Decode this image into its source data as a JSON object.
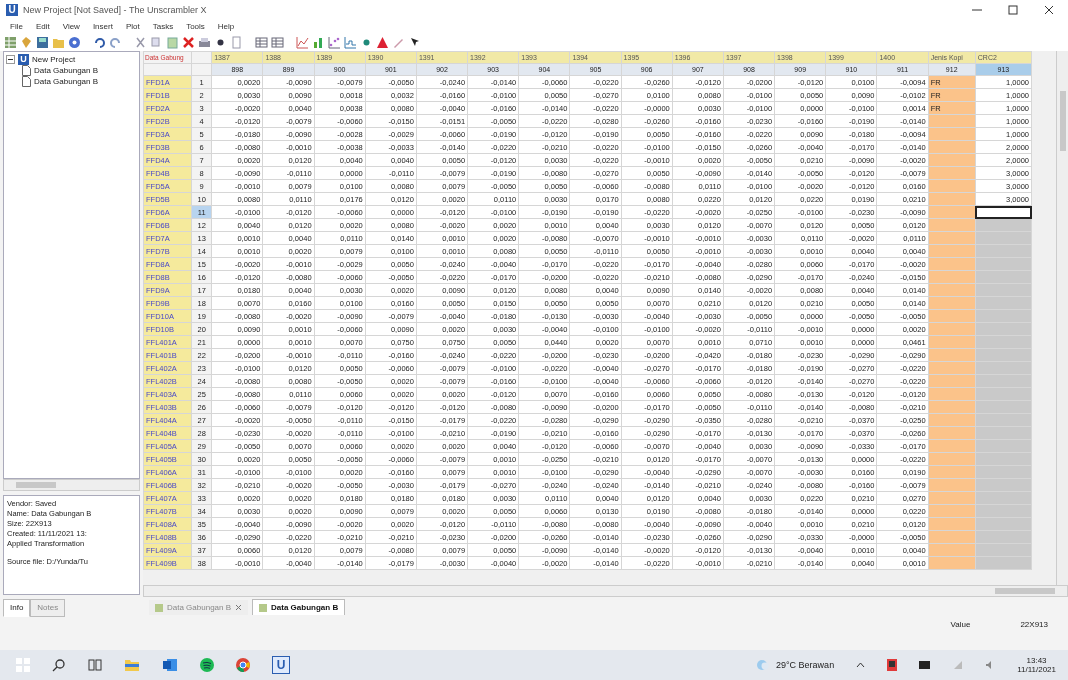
{
  "window": {
    "title": "New Project [Not Saved] - The Unscrambler X",
    "icon_glyph": "U"
  },
  "menu": [
    "File",
    "Edit",
    "View",
    "Insert",
    "Plot",
    "Tasks",
    "Tools",
    "Help"
  ],
  "project_tree": {
    "label": "New Project",
    "icon_glyph": "U",
    "expanded": true,
    "children": [
      {
        "label": "Data Gabungan B"
      },
      {
        "label": "Data Gabungan B"
      }
    ]
  },
  "info_panel": {
    "lines": [
      "Vendor: Saved",
      "Name: Data Gabungan B",
      "Size: 22X913",
      "Created: 11/11/2021 13:",
      "Applied Transformation",
      "Source file: D:/Yunda/Tu"
    ]
  },
  "side_tabs": [
    {
      "label": "Info",
      "selected": true
    },
    {
      "label": "Notes",
      "selected": false
    }
  ],
  "table": {
    "corner": "Data Gabung",
    "top_headers": [
      "1387",
      "1388",
      "1389",
      "1390",
      "1391",
      "1392",
      "1393",
      "1394",
      "1395",
      "1396",
      "1397",
      "1398",
      "1399",
      "1400",
      "Jenis Kopi",
      "CRC2"
    ],
    "sub_headers": [
      "898",
      "899",
      "900",
      "901",
      "902",
      "903",
      "904",
      "905",
      "906",
      "907",
      "908",
      "909",
      "910",
      "911",
      "912",
      "913"
    ],
    "rows": [
      {
        "name": "FFD1A",
        "index": "1",
        "selected": false,
        "jenis_kopi": "FR",
        "last_value": "1,0000",
        "values": [
          "0,0020",
          "-0,0090",
          "-0,0079",
          "-0,0050",
          "-0,0240",
          "-0,0140",
          "-0,0060",
          "-0,0220",
          "-0,0260",
          "-0,0120",
          "-0,0200",
          "-0,0120",
          "0,0100",
          "-0,0094"
        ]
      },
      {
        "name": "FFD1B",
        "index": "2",
        "selected": false,
        "jenis_kopi": "FR",
        "last_value": "1,0000",
        "values": [
          "0,0030",
          "0,0090",
          "0,0018",
          "0,0032",
          "-0,0160",
          "-0,0100",
          "0,0050",
          "-0,0270",
          "0,0100",
          "0,0080",
          "-0,0100",
          "0,0050",
          "0,0090",
          "-0,0102"
        ]
      },
      {
        "name": "FFD2A",
        "index": "3",
        "selected": false,
        "jenis_kopi": "FR",
        "last_value": "1,0000",
        "values": [
          "-0,0020",
          "0,0040",
          "0,0038",
          "0,0080",
          "-0,0040",
          "-0,0160",
          "-0,0140",
          "-0,0220",
          "-0,0000",
          "0,0030",
          "-0,0100",
          "0,0000",
          "-0,0100",
          "0,0014"
        ]
      },
      {
        "name": "FFD2B",
        "index": "4",
        "selected": false,
        "last_value": "1,0000",
        "values": [
          "-0,0120",
          "-0,0079",
          "-0,0060",
          "-0,0150",
          "-0,0151",
          "-0,0050",
          "-0,0220",
          "-0,0280",
          "-0,0260",
          "-0,0160",
          "-0,0230",
          "-0,0160",
          "-0,0190",
          "-0,0140"
        ]
      },
      {
        "name": "FFD3A",
        "index": "5",
        "selected": false,
        "last_value": "1,0000",
        "values": [
          "-0,0180",
          "-0,0090",
          "-0,0028",
          "-0,0029",
          "-0,0060",
          "-0,0190",
          "-0,0120",
          "-0,0190",
          "0,0050",
          "-0,0160",
          "-0,0220",
          "0,0090",
          "-0,0180",
          "-0,0094"
        ]
      },
      {
        "name": "FFD3B",
        "index": "6",
        "selected": false,
        "last_value": "2,0000",
        "values": [
          "-0,0080",
          "-0,0010",
          "-0,0038",
          "-0,0033",
          "-0,0140",
          "-0,0220",
          "-0,0210",
          "-0,0220",
          "-0,0100",
          "-0,0150",
          "-0,0260",
          "-0,0040",
          "-0,0170",
          "-0,0140"
        ]
      },
      {
        "name": "FFD4A",
        "index": "7",
        "selected": false,
        "last_value": "2,0000",
        "values": [
          "0,0020",
          "0,0120",
          "0,0040",
          "0,0040",
          "0,0050",
          "-0,0120",
          "0,0030",
          "-0,0220",
          "-0,0010",
          "0,0020",
          "-0,0050",
          "0,0210",
          "-0,0090",
          "-0,0020"
        ]
      },
      {
        "name": "FFD4B",
        "index": "8",
        "selected": false,
        "last_value": "3,0000",
        "values": [
          "-0,0090",
          "-0,0110",
          "0,0000",
          "-0,0110",
          "-0,0079",
          "-0,0190",
          "-0,0080",
          "-0,0270",
          "0,0050",
          "-0,0090",
          "-0,0140",
          "-0,0050",
          "-0,0120",
          "-0,0079"
        ]
      },
      {
        "name": "FFD5A",
        "index": "9",
        "selected": false,
        "last_value": "3,0000",
        "values": [
          "-0,0010",
          "0,0079",
          "0,0100",
          "0,0080",
          "0,0079",
          "-0,0050",
          "0,0050",
          "-0,0060",
          "-0,0080",
          "0,0110",
          "-0,0100",
          "-0,0020",
          "-0,0120",
          "0,0160"
        ]
      },
      {
        "name": "FFD5B",
        "index": "10",
        "selected": false,
        "last_value": "3,0000",
        "values": [
          "0,0080",
          "0,0110",
          "0,0176",
          "0,0120",
          "0,0020",
          "0,0110",
          "0,0030",
          "0,0170",
          "0,0080",
          "0,0220",
          "0,0120",
          "0,0220",
          "0,0190",
          "0,0210"
        ]
      },
      {
        "name": "FFD6A",
        "index": "11",
        "selected": true,
        "values": [
          "-0,0100",
          "-0,0120",
          "-0,0060",
          "0,0000",
          "-0,0120",
          "-0,0100",
          "-0,0190",
          "-0,0190",
          "-0,0220",
          "-0,0020",
          "-0,0250",
          "-0,0100",
          "-0,0230",
          "-0,0090"
        ]
      },
      {
        "name": "FFD6B",
        "index": "12",
        "selected": false,
        "values": [
          "0,0040",
          "0,0120",
          "0,0020",
          "0,0080",
          "-0,0020",
          "0,0020",
          "0,0010",
          "0,0040",
          "0,0030",
          "0,0120",
          "-0,0070",
          "0,0120",
          "0,0050",
          "0,0120"
        ]
      },
      {
        "name": "FFD7A",
        "index": "13",
        "selected": false,
        "values": [
          "0,0010",
          "0,0040",
          "0,0110",
          "0,0140",
          "0,0010",
          "0,0020",
          "-0,0080",
          "-0,0070",
          "-0,0010",
          "-0,0010",
          "-0,0030",
          "0,0110",
          "-0,0020",
          "0,0110"
        ]
      },
      {
        "name": "FFD7B",
        "index": "14",
        "selected": false,
        "values": [
          "0,0010",
          "0,0020",
          "0,0079",
          "0,0100",
          "0,0010",
          "0,0080",
          "0,0050",
          "-0,0110",
          "0,0050",
          "-0,0010",
          "-0,0030",
          "0,0010",
          "0,0040",
          "0,0040"
        ]
      },
      {
        "name": "FFD8A",
        "index": "15",
        "selected": false,
        "values": [
          "-0,0020",
          "-0,0010",
          "-0,0029",
          "0,0050",
          "-0,0240",
          "-0,0040",
          "-0,0170",
          "-0,0220",
          "-0,0170",
          "-0,0040",
          "-0,0280",
          "0,0060",
          "-0,0170",
          "-0,0020"
        ]
      },
      {
        "name": "FFD8B",
        "index": "16",
        "selected": false,
        "values": [
          "-0,0120",
          "-0,0080",
          "-0,0060",
          "-0,0050",
          "-0,0220",
          "-0,0170",
          "-0,0200",
          "-0,0220",
          "-0,0210",
          "-0,0080",
          "-0,0290",
          "-0,0170",
          "-0,0240",
          "-0,0150"
        ]
      },
      {
        "name": "FFD9A",
        "index": "17",
        "selected": false,
        "values": [
          "0,0180",
          "0,0040",
          "0,0030",
          "0,0020",
          "0,0090",
          "0,0120",
          "0,0080",
          "0,0040",
          "0,0090",
          "0,0140",
          "-0,0020",
          "0,0080",
          "0,0040",
          "0,0140"
        ]
      },
      {
        "name": "FFD9B",
        "index": "18",
        "selected": false,
        "values": [
          "0,0070",
          "0,0160",
          "0,0100",
          "0,0160",
          "0,0050",
          "0,0150",
          "0,0050",
          "0,0050",
          "0,0070",
          "0,0210",
          "0,0120",
          "0,0210",
          "0,0050",
          "0,0140"
        ]
      },
      {
        "name": "FFD10A",
        "index": "19",
        "selected": false,
        "values": [
          "-0,0080",
          "-0,0020",
          "-0,0090",
          "-0,0079",
          "-0,0040",
          "-0,0180",
          "-0,0130",
          "-0,0030",
          "-0,0040",
          "-0,0030",
          "-0,0050",
          "0,0000",
          "-0,0050",
          "-0,0050"
        ]
      },
      {
        "name": "FFD10B",
        "index": "20",
        "selected": false,
        "values": [
          "0,0090",
          "0,0010",
          "-0,0060",
          "0,0090",
          "0,0020",
          "0,0030",
          "-0,0040",
          "-0,0100",
          "-0,0100",
          "-0,0020",
          "-0,0110",
          "-0,0010",
          "0,0000",
          "0,0020"
        ]
      },
      {
        "name": "FFL401A",
        "index": "21",
        "selected": false,
        "values": [
          "0,0000",
          "0,0010",
          "0,0070",
          "0,0750",
          "0,0750",
          "0,0050",
          "0,0440",
          "0,0020",
          "0,0070",
          "0,0010",
          "0,0710",
          "0,0010",
          "0,0000",
          "0,0461"
        ]
      },
      {
        "name": "FFL401B",
        "index": "22",
        "selected": false,
        "values": [
          "-0,0200",
          "-0,0010",
          "-0,0110",
          "-0,0160",
          "-0,0240",
          "-0,0220",
          "-0,0200",
          "-0,0230",
          "-0,0200",
          "-0,0420",
          "-0,0180",
          "-0,0230",
          "-0,0290",
          "-0,0290"
        ]
      },
      {
        "name": "FFL402A",
        "index": "23",
        "selected": false,
        "values": [
          "-0,0100",
          "0,0120",
          "0,0050",
          "-0,0060",
          "-0,0079",
          "-0,0100",
          "-0,0220",
          "-0,0040",
          "-0,0270",
          "-0,0170",
          "-0,0180",
          "-0,0190",
          "-0,0270",
          "-0,0220"
        ]
      },
      {
        "name": "FFL402B",
        "index": "24",
        "selected": false,
        "values": [
          "-0,0080",
          "0,0080",
          "-0,0050",
          "0,0020",
          "-0,0079",
          "-0,0160",
          "-0,0100",
          "-0,0040",
          "-0,0060",
          "-0,0060",
          "-0,0120",
          "-0,0140",
          "-0,0270",
          "-0,0220"
        ]
      },
      {
        "name": "FFL403A",
        "index": "25",
        "selected": false,
        "values": [
          "-0,0080",
          "0,0110",
          "0,0060",
          "0,0020",
          "0,0020",
          "-0,0120",
          "0,0070",
          "-0,0160",
          "0,0060",
          "0,0050",
          "-0,0080",
          "-0,0130",
          "-0,0120",
          "-0,0120"
        ]
      },
      {
        "name": "FFL403B",
        "index": "26",
        "selected": false,
        "values": [
          "-0,0060",
          "-0,0079",
          "-0,0120",
          "-0,0120",
          "-0,0120",
          "-0,0080",
          "-0,0090",
          "-0,0200",
          "-0,0170",
          "-0,0050",
          "-0,0110",
          "-0,0140",
          "-0,0080",
          "-0,0210"
        ]
      },
      {
        "name": "FFL404A",
        "index": "27",
        "selected": false,
        "values": [
          "-0,0020",
          "-0,0050",
          "-0,0110",
          "-0,0150",
          "-0,0179",
          "-0,0220",
          "-0,0280",
          "-0,0290",
          "-0,0290",
          "-0,0350",
          "-0,0280",
          "-0,0210",
          "-0,0370",
          "-0,0250"
        ]
      },
      {
        "name": "FFL404B",
        "index": "28",
        "selected": false,
        "values": [
          "-0,0230",
          "-0,0020",
          "-0,0110",
          "-0,0100",
          "-0,0210",
          "-0,0190",
          "-0,0210",
          "-0,0160",
          "-0,0290",
          "-0,0170",
          "-0,0130",
          "-0,0170",
          "-0,0370",
          "-0,0260"
        ]
      },
      {
        "name": "FFL405A",
        "index": "29",
        "selected": false,
        "values": [
          "-0,0050",
          "0,0070",
          "0,0060",
          "0,0020",
          "0,0020",
          "0,0040",
          "-0,0120",
          "-0,0060",
          "-0,0070",
          "-0,0040",
          "0,0030",
          "-0,0090",
          "-0,0330",
          "-0,0170"
        ]
      },
      {
        "name": "FFL405B",
        "index": "30",
        "selected": false,
        "values": [
          "0,0020",
          "0,0050",
          "-0,0050",
          "-0,0060",
          "-0,0079",
          "0,0010",
          "-0,0250",
          "-0,0210",
          "0,0120",
          "-0,0170",
          "-0,0070",
          "-0,0130",
          "0,0000",
          "-0,0220"
        ]
      },
      {
        "name": "FFL406A",
        "index": "31",
        "selected": false,
        "values": [
          "-0,0100",
          "-0,0100",
          "0,0020",
          "-0,0160",
          "0,0079",
          "0,0010",
          "-0,0100",
          "-0,0290",
          "-0,0040",
          "-0,0290",
          "-0,0070",
          "-0,0030",
          "0,0160",
          "0,0190"
        ]
      },
      {
        "name": "FFL406B",
        "index": "32",
        "selected": false,
        "values": [
          "-0,0210",
          "-0,0020",
          "-0,0050",
          "-0,0030",
          "-0,0179",
          "-0,0270",
          "-0,0240",
          "-0,0240",
          "-0,0140",
          "-0,0210",
          "-0,0240",
          "-0,0080",
          "-0,0160",
          "-0,0079"
        ]
      },
      {
        "name": "FFL407A",
        "index": "33",
        "selected": false,
        "values": [
          "0,0020",
          "0,0020",
          "0,0180",
          "0,0180",
          "0,0180",
          "0,0030",
          "0,0110",
          "0,0040",
          "0,0120",
          "0,0040",
          "0,0030",
          "0,0220",
          "0,0210",
          "0,0270"
        ]
      },
      {
        "name": "FFL407B",
        "index": "34",
        "selected": false,
        "values": [
          "0,0030",
          "0,0020",
          "0,0090",
          "0,0079",
          "0,0020",
          "0,0050",
          "0,0060",
          "0,0130",
          "0,0190",
          "-0,0080",
          "-0,0180",
          "-0,0140",
          "0,0000",
          "0,0220"
        ]
      },
      {
        "name": "FFL408A",
        "index": "35",
        "selected": false,
        "values": [
          "-0,0040",
          "-0,0090",
          "-0,0020",
          "0,0020",
          "-0,0120",
          "-0,0110",
          "-0,0080",
          "-0,0080",
          "-0,0040",
          "-0,0090",
          "-0,0040",
          "0,0010",
          "0,0210",
          "0,0120"
        ]
      },
      {
        "name": "FFL408B",
        "index": "36",
        "selected": false,
        "values": [
          "-0,0290",
          "-0,0220",
          "-0,0210",
          "-0,0210",
          "-0,0230",
          "-0,0200",
          "-0,0260",
          "-0,0140",
          "-0,0230",
          "-0,0260",
          "-0,0290",
          "-0,0330",
          "-0,0000",
          "-0,0050"
        ]
      },
      {
        "name": "FFL409A",
        "index": "37",
        "selected": false,
        "values": [
          "0,0060",
          "0,0120",
          "0,0079",
          "-0,0080",
          "0,0079",
          "0,0050",
          "-0,0090",
          "-0,0140",
          "-0,0020",
          "-0,0120",
          "-0,0130",
          "-0,0040",
          "0,0010",
          "0,0040"
        ]
      },
      {
        "name": "FFL409B",
        "index": "38",
        "selected": false,
        "values": [
          "-0,0010",
          "-0,0040",
          "-0,0140",
          "-0,0179",
          "-0,0030",
          "-0,0040",
          "-0,0020",
          "-0,0140",
          "-0,0220",
          "-0,0010",
          "-0,0210",
          "-0,0140",
          "0,0040",
          "0,0010"
        ]
      }
    ]
  },
  "sheet_tabs": [
    {
      "label": "Data Gabungan B",
      "selected": false,
      "closable": true
    },
    {
      "label": "Data Gabungan B",
      "selected": true,
      "closable": false
    }
  ],
  "status_bar": {
    "label": "Value",
    "value": "22X913"
  },
  "taskbar": {
    "app_glyph": "U",
    "weather": "29°C Berawan",
    "time": "13:43",
    "date": "11/11/2021"
  }
}
